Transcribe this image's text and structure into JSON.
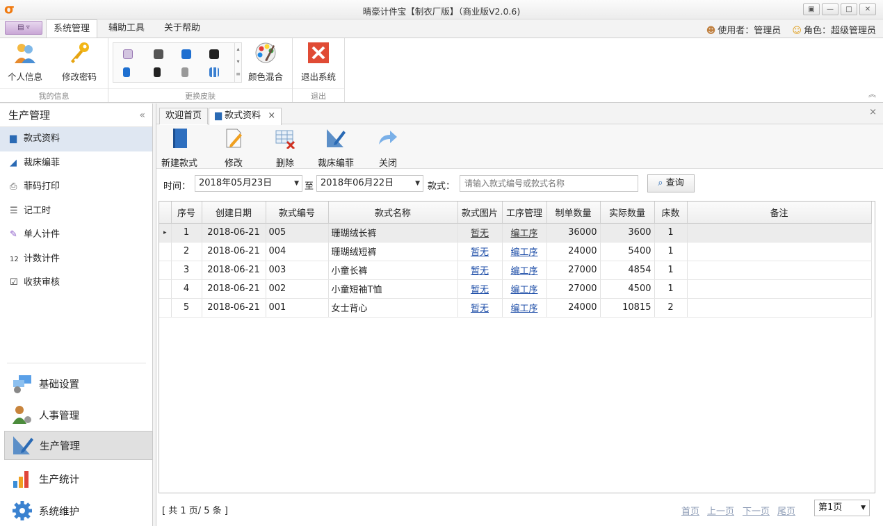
{
  "window": {
    "title": "晴豪计件宝【制衣厂版】（商业版V2.0.6)",
    "btn_restore": "▣",
    "btn_min": "—",
    "btn_max": "□",
    "btn_close": "✕"
  },
  "menu": {
    "tabs": [
      "系统管理",
      "辅助工具",
      "关于帮助"
    ],
    "user_label": "使用者：管理员",
    "role_label": "角色：超级管理员"
  },
  "ribbon": {
    "groups": [
      {
        "label": "我的信息",
        "buttons": [
          "个人信息",
          "修改密码"
        ]
      },
      {
        "label": "更换皮肤",
        "buttons": [
          "颜色混合"
        ]
      },
      {
        "label": "退出",
        "buttons": [
          "退出系统"
        ]
      }
    ]
  },
  "nav": {
    "header": "生产管理",
    "collapse": "«",
    "items": [
      "款式资料",
      "裁床编菲",
      "菲码打印",
      "记工时",
      "单人计件",
      "计数计件",
      "收获审核"
    ],
    "groups": [
      "基础设置",
      "人事管理",
      "生产管理",
      "生产统计",
      "系统维护"
    ]
  },
  "doc_tabs": {
    "tabs": [
      "欢迎首页",
      "款式资料"
    ],
    "close": "×"
  },
  "toolbar": {
    "buttons": [
      "新建款式",
      "修改",
      "删除",
      "裁床编菲",
      "关闭"
    ]
  },
  "filter": {
    "time_label": "时间：",
    "date_from": "2018年05月23日",
    "to_label": "至",
    "date_to": "2018年06月22日",
    "style_label": "款式：",
    "search_placeholder": "请输入款式编号或款式名称",
    "search_button": "查询"
  },
  "table": {
    "columns": [
      "序号",
      "创建日期",
      "款式编号",
      "款式名称",
      "款式图片",
      "工序管理",
      "制单数量",
      "实际数量",
      "床数",
      "备注"
    ],
    "rows": [
      {
        "no": "1",
        "date": "2018-06-21",
        "code": "005",
        "name": "珊瑚绒长裤",
        "img": "暂无",
        "proc": "编工序",
        "order_qty": "36000",
        "actual_qty": "3600",
        "beds": "1",
        "note": ""
      },
      {
        "no": "2",
        "date": "2018-06-21",
        "code": "004",
        "name": "珊瑚绒短裤",
        "img": "暂无",
        "proc": "编工序",
        "order_qty": "24000",
        "actual_qty": "5400",
        "beds": "1",
        "note": ""
      },
      {
        "no": "3",
        "date": "2018-06-21",
        "code": "003",
        "name": "小童长裤",
        "img": "暂无",
        "proc": "编工序",
        "order_qty": "27000",
        "actual_qty": "4854",
        "beds": "1",
        "note": ""
      },
      {
        "no": "4",
        "date": "2018-06-21",
        "code": "002",
        "name": "小童短袖T恤",
        "img": "暂无",
        "proc": "编工序",
        "order_qty": "27000",
        "actual_qty": "4500",
        "beds": "1",
        "note": ""
      },
      {
        "no": "5",
        "date": "2018-06-21",
        "code": "001",
        "name": "女士背心",
        "img": "暂无",
        "proc": "编工序",
        "order_qty": "24000",
        "actual_qty": "10815",
        "beds": "2",
        "note": ""
      }
    ]
  },
  "pager": {
    "summary": "[ 共 1 页/ 5 条 ]",
    "first": "首页",
    "prev": "上一页",
    "next": "下一页",
    "last": "尾页",
    "current": "第1页"
  }
}
